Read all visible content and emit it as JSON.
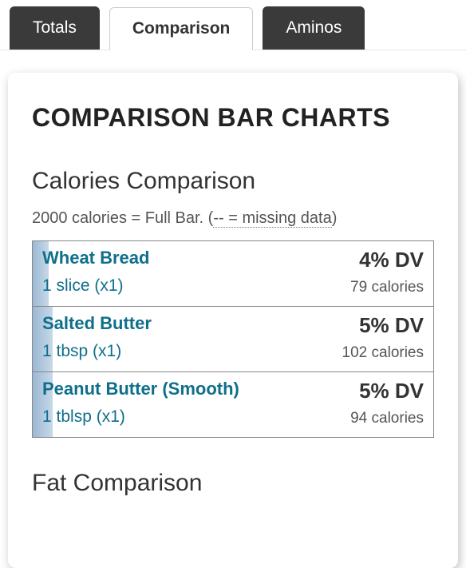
{
  "tabs": {
    "totals": "Totals",
    "comparison": "Comparison",
    "aminos": "Aminos"
  },
  "title": "COMPARISON BAR CHARTS",
  "section1_title": "Calories Comparison",
  "legend_prefix": "2000 calories = Full Bar. (",
  "legend_missing": "-- = missing data",
  "legend_suffix": ")",
  "section2_title": "Fat Comparison",
  "chart_data": {
    "type": "bar",
    "title": "Calories Comparison",
    "full_bar_value": 2000,
    "unit": "calories",
    "items": [
      {
        "name": "Wheat Bread",
        "serving": "1 slice (x1)",
        "dv": "4% DV",
        "abs": "79 calories",
        "value": 79,
        "dv_pct": 4
      },
      {
        "name": "Salted Butter",
        "serving": "1 tbsp (x1)",
        "dv": "5% DV",
        "abs": "102 calories",
        "value": 102,
        "dv_pct": 5
      },
      {
        "name": "Peanut Butter (Smooth)",
        "serving": "1 tblsp (x1)",
        "dv": "5% DV",
        "abs": "94 calories",
        "value": 94,
        "dv_pct": 5
      }
    ]
  }
}
